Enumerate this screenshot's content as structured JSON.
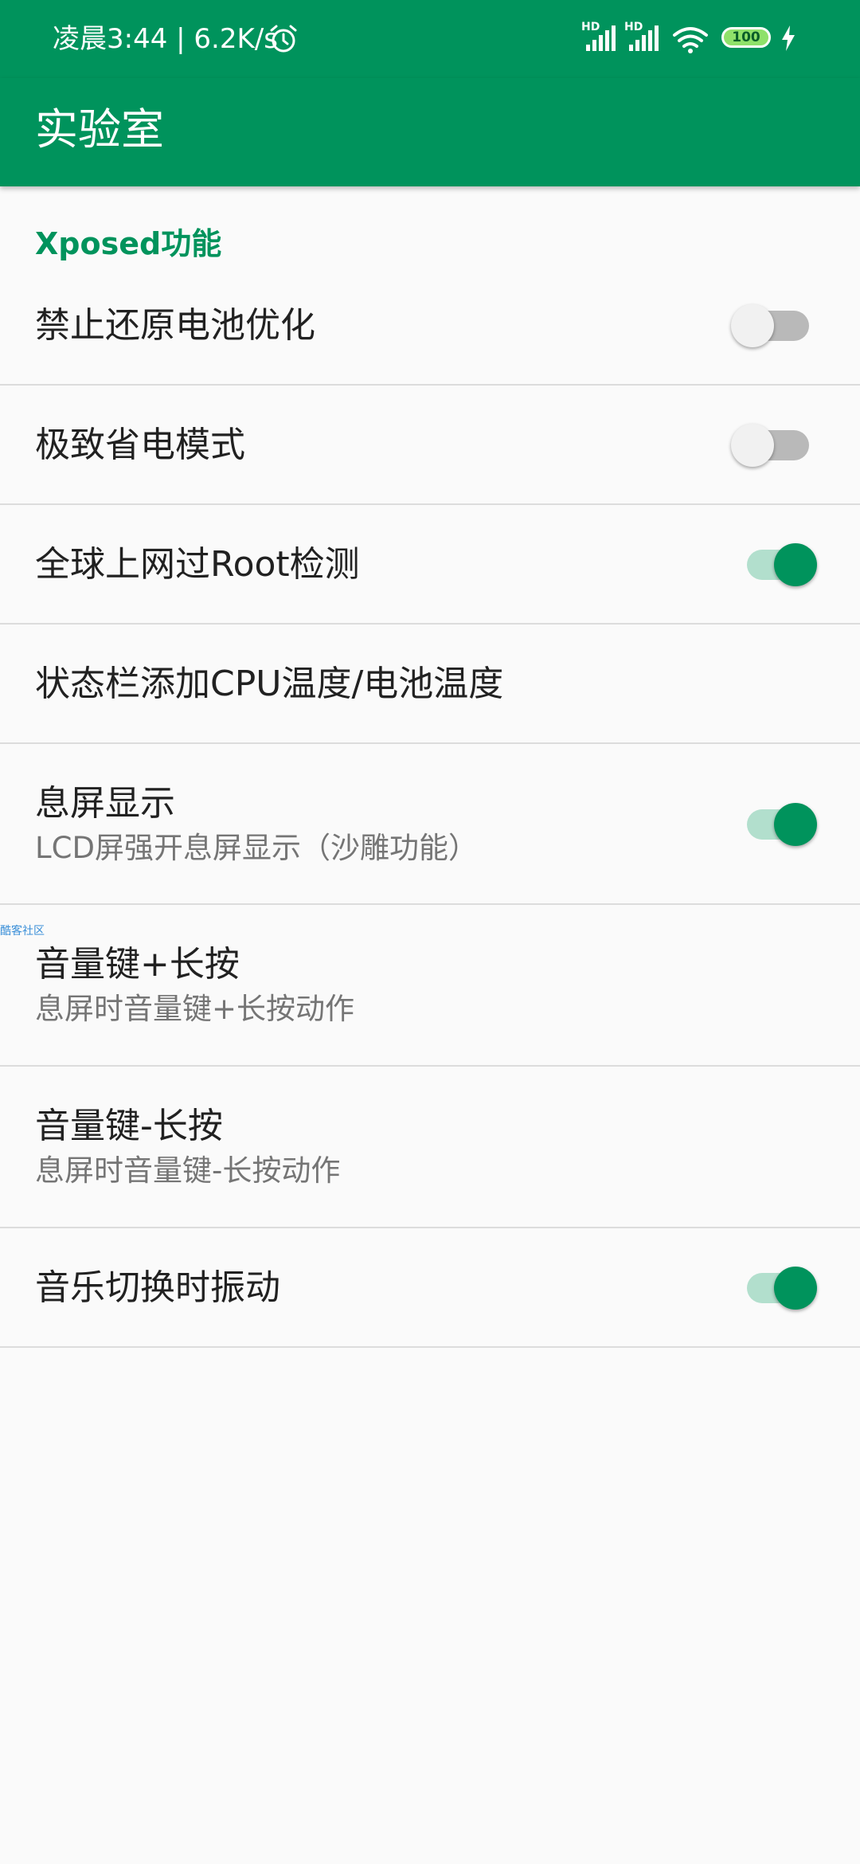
{
  "status_bar": {
    "time_text": "凌晨3:44 | 6.2K/s",
    "signal_1_label": "HD",
    "signal_2_label": "HD",
    "battery_level": "100",
    "icons": [
      "alarm-icon",
      "signal-icon",
      "signal-icon",
      "wifi-icon",
      "battery-icon",
      "charging-icon"
    ]
  },
  "app_bar": {
    "title": "实验室"
  },
  "section": {
    "header": "Xposed功能"
  },
  "settings": [
    {
      "title": "禁止还原电池优化",
      "switch_on": false
    },
    {
      "title": "极致省电模式",
      "switch_on": false
    },
    {
      "title": "全球上网过Root检测",
      "switch_on": true
    },
    {
      "title": "状态栏添加CPU温度/电池温度"
    },
    {
      "title": "息屏显示",
      "subtitle": "LCD屏强开息屏显示（沙雕功能）",
      "switch_on": true
    },
    {
      "title": "音量键+长按",
      "subtitle": "息屏时音量键+长按动作"
    },
    {
      "title": "音量键-长按",
      "subtitle": "息屏时音量键-长按动作"
    },
    {
      "title": "音乐切换时振动",
      "switch_on": true
    }
  ],
  "watermark": "酷客社区",
  "colors": {
    "accent": "#00935c",
    "switch_track_on": "#b2dfcd",
    "switch_track_off": "#b9b9b9",
    "background": "#fafafa"
  }
}
